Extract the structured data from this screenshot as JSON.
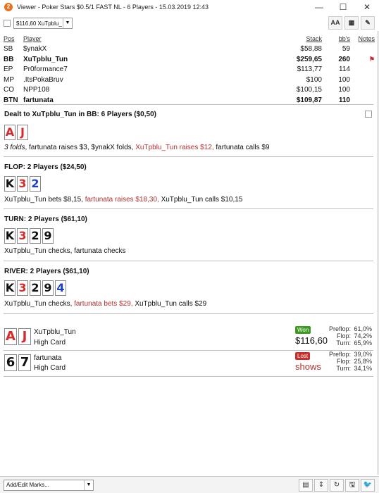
{
  "window": {
    "title": "Viewer - Poker Stars $0.5/1 FAST NL - 6 Players - 15.03.2019 12:43",
    "app_icon": "2",
    "minimize": "—",
    "maximize": "☐",
    "close": "✕"
  },
  "toolbar": {
    "hand_selector_value": "$116,60 XuTpblu_",
    "dropdown_arrow": "▼",
    "btn_font": "AA",
    "btn_grid": "▦",
    "btn_edit": "✎"
  },
  "players": {
    "headers": {
      "pos": "Pos",
      "player": "Player",
      "stack": "Stack",
      "bbs": "bb's",
      "notes": "Notes"
    },
    "rows": [
      {
        "pos": "SB",
        "player": "$ynakX",
        "stack": "$58,88",
        "bbs": "59",
        "bold": false,
        "flag": ""
      },
      {
        "pos": "BB",
        "player": "XuTpblu_Tun",
        "stack": "$259,65",
        "bbs": "260",
        "bold": true,
        "flag": "⚑"
      },
      {
        "pos": "EP",
        "player": "Pr0formance7",
        "stack": "$113,77",
        "bbs": "114",
        "bold": false,
        "flag": ""
      },
      {
        "pos": "MP",
        "player": ".ItsPokaBruv",
        "stack": "$100",
        "bbs": "100",
        "bold": false,
        "flag": ""
      },
      {
        "pos": "CO",
        "player": "NPP108",
        "stack": "$100,15",
        "bbs": "100",
        "bold": false,
        "flag": ""
      },
      {
        "pos": "BTN",
        "player": "fartunata",
        "stack": "$109,87",
        "bbs": "110",
        "bold": true,
        "flag": ""
      }
    ]
  },
  "preflop": {
    "title": "Dealt to XuTpblu_Tun in BB: 6 Players ($0,50)",
    "cards": [
      "A",
      "J"
    ],
    "a1": "3 folds",
    "a2": ", fartunata raises $3, $ynakX folds, ",
    "a3": "XuTpblu_Tun raises $12,",
    "a4": " fartunata calls $9"
  },
  "flop": {
    "title": "FLOP: 2 Players ($24,50)",
    "cards": [
      "K",
      "3",
      "2"
    ],
    "a1": "XuTpblu_Tun bets $8,15, ",
    "a2": "fartunata raises $18,30,",
    "a3": " XuTpblu_Tun calls $10,15"
  },
  "turn": {
    "title": "TURN: 2 Players ($61,10)",
    "cards": [
      "K",
      "3",
      "2",
      "9"
    ],
    "a1": "XuTpblu_Tun checks, fartunata checks"
  },
  "river": {
    "title": "RIVER: 2 Players ($61,10)",
    "cards": [
      "K",
      "3",
      "2",
      "9",
      "4"
    ],
    "a1": "XuTpblu_Tun checks, ",
    "a2": "fartunata bets $29,",
    "a3": " XuTpblu_Tun calls $29"
  },
  "results": [
    {
      "cards": [
        "A",
        "J"
      ],
      "name": "XuTpblu_Tun",
      "hand": "High Card",
      "badge": "Won",
      "amount": "$116,60",
      "stats": [
        {
          "label": "Preflop:",
          "pct": "61,0%"
        },
        {
          "label": "Flop:",
          "pct": "74,2%"
        },
        {
          "label": "Turn:",
          "pct": "65,9%"
        }
      ]
    },
    {
      "cards": [
        "6",
        "7"
      ],
      "name": "fartunata",
      "hand": "High Card",
      "badge": "Lost",
      "amount": "shows",
      "stats": [
        {
          "label": "Preflop:",
          "pct": "39,0%"
        },
        {
          "label": "Flop:",
          "pct": "25,8%"
        },
        {
          "label": "Turn:",
          "pct": "34,1%"
        }
      ]
    }
  ],
  "footer": {
    "marks_value": "Add/Edit Marks...",
    "dropdown_arrow": "▼",
    "btn_doc": "▤",
    "btn_updown": "⇕",
    "btn_refresh": "↻",
    "btn_save": "🖫",
    "btn_twitter": "🐦"
  },
  "colors": {
    "red_suit": "#d82a2a",
    "blue_suit": "#1c3fc7",
    "action_red": "#b03030",
    "won_badge": "#3c9a1f",
    "lost_badge": "#c8302c"
  }
}
